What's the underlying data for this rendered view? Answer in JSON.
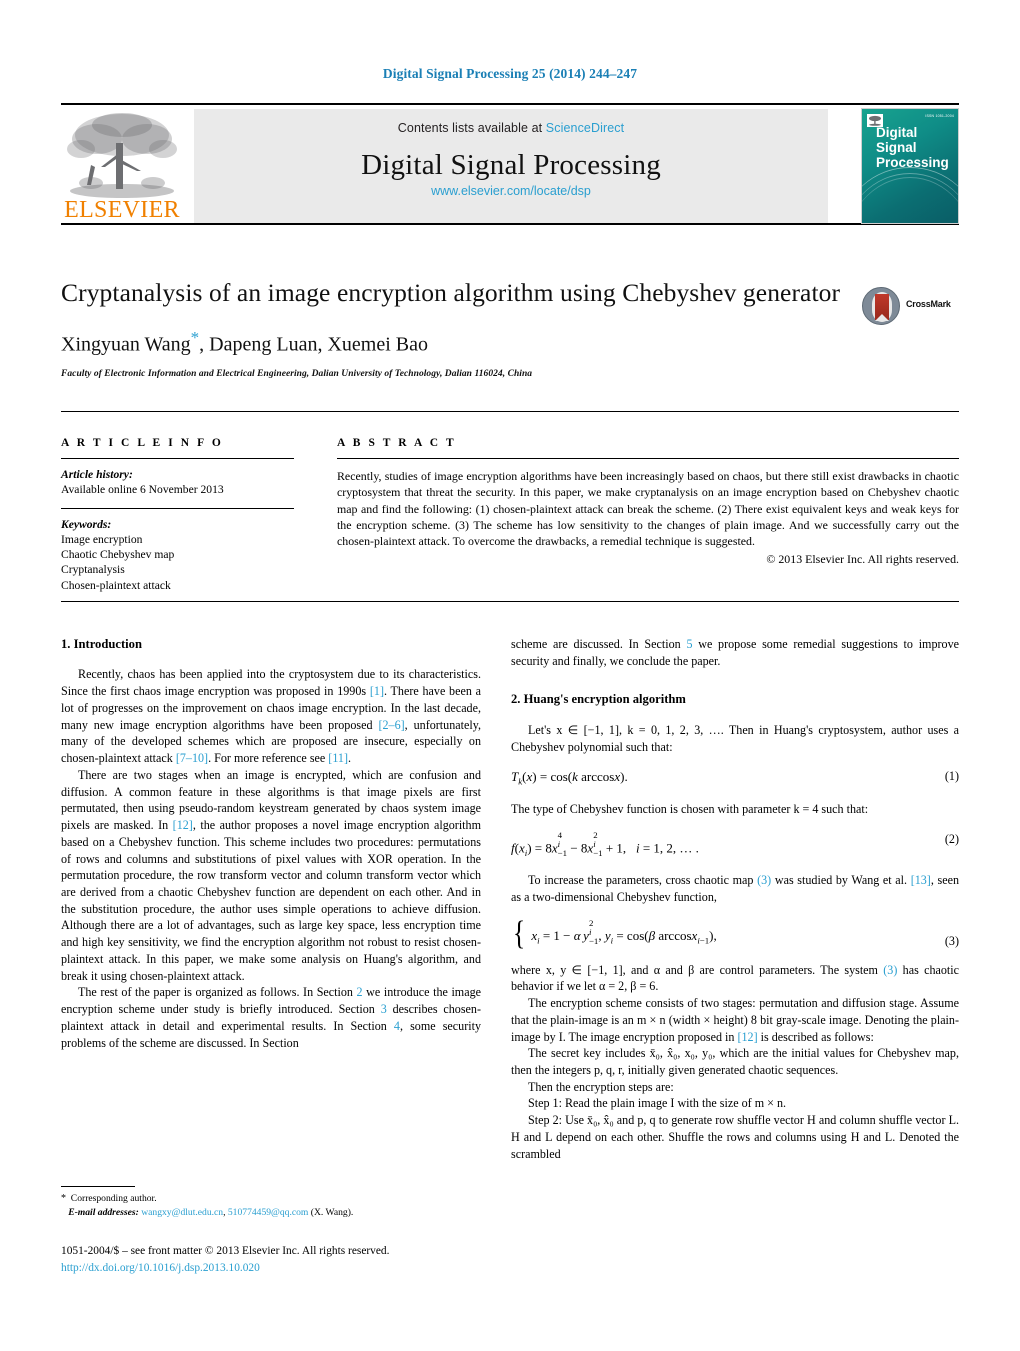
{
  "running_head": "Digital Signal Processing 25 (2014) 244–247",
  "masthead": {
    "publisher_logo_text": "ELSEVIER",
    "contents_prefix": "Contents lists available at ",
    "contents_link": "ScienceDirect",
    "journal_title": "Digital Signal Processing",
    "journal_url": "www.elsevier.com/locate/dsp",
    "cover_title_line1": "Digital",
    "cover_title_line2": "Signal",
    "cover_title_line3": "Processing",
    "cover_corner_text": "ISSN 1051-2004"
  },
  "article": {
    "title": "Cryptanalysis of an image encryption algorithm using Chebyshev generator",
    "authors": "Xingyuan Wang",
    "authors_rest": ", Dapeng Luan, Xuemei Bao",
    "corresponding_marker": "*",
    "affiliation": "Faculty of Electronic Information and Electrical Engineering, Dalian University of Technology, Dalian 116024, China",
    "crossmark_label": "CrossMark"
  },
  "info": {
    "heading": "A R T I C L E   I N F O",
    "history_label": "Article history:",
    "history_value": "Available online 6 November 2013",
    "keywords_label": "Keywords:",
    "keywords": [
      "Image encryption",
      "Chaotic Chebyshev map",
      "Cryptanalysis",
      "Chosen-plaintext attack"
    ]
  },
  "abstract": {
    "heading": "A B S T R A C T",
    "body": "Recently, studies of image encryption algorithms have been increasingly based on chaos, but there still exist drawbacks in chaotic cryptosystem that threat the security. In this paper, we make cryptanalysis on an image encryption based on Chebyshev chaotic map and find the following: (1) chosen-plaintext attack can break the scheme. (2) There exist equivalent keys and weak keys for the encryption scheme. (3) The scheme has low sensitivity to the changes of plain image. And we successfully carry out the chosen-plaintext attack. To overcome the drawbacks, a remedial technique is suggested.",
    "copyright": "© 2013 Elsevier Inc. All rights reserved."
  },
  "body": {
    "section1_heading": "1. Introduction",
    "p1_a": "Recently, chaos has been applied into the cryptosystem due to its characteristics. Since the first chaos image encryption was proposed in 1990s ",
    "p1_ref1": "[1]",
    "p1_b": ". There have been a lot of progresses on the improvement on chaos image encryption. In the last decade, many new image encryption algorithms have been proposed ",
    "p1_ref2": "[2–6]",
    "p1_c": ", unfortunately, many of the developed schemes which are proposed are insecure, especially on chosen-plaintext attack ",
    "p1_ref3": "[7–10]",
    "p1_d": ". For more reference see ",
    "p1_ref4": "[11]",
    "p1_e": ".",
    "p2_a": "There are two stages when an image is encrypted, which are confusion and diffusion. A common feature in these algorithms is that image pixels are first permutated, then using pseudo-random keystream generated by chaos system image pixels are masked. In ",
    "p2_ref1": "[12]",
    "p2_b": ", the author proposes a novel image encryption algorithm based on a Chebyshev function. This scheme includes two procedures: permutations of rows and columns and substitutions of pixel values with XOR operation. In the permutation procedure, the row transform vector and column transform vector which are derived from a chaotic Chebyshev function are dependent on each other. And in the substitution procedure, the author uses simple operations to achieve diffusion. Although there are a lot of advantages, such as large key space, less encryption time and high key sensitivity, we find the encryption algorithm not robust to resist chosen-plaintext attack. In this paper, we make some analysis on Huang's algorithm, and break it using chosen-plaintext attack.",
    "p3_a": "The rest of the paper is organized as follows. In Section ",
    "p3_ref1": "2",
    "p3_b": " we introduce the image encryption scheme under study is briefly introduced. Section ",
    "p3_ref2": "3",
    "p3_c": " describes chosen-plaintext attack in detail and experimental results. In Section ",
    "p3_ref3": "4",
    "p3_d": ", some security problems of the scheme are discussed. In Section ",
    "p3_ref4": "5",
    "p3_e": " we propose some remedial suggestions to improve security and finally, we conclude the paper.",
    "section2_heading": "2. Huang's encryption algorithm",
    "p4_a": "Let's x ∈ [−1, 1],  k = 0, 1, 2, 3, …. Then in Huang's cryptosystem, author uses a Chebyshev polynomial such that:",
    "eq1_text": "T",
    "eq1_number": "(1)",
    "p5_a": "The type of Chebyshev function is chosen with parameter k = 4 such that:",
    "eq2_number": "(2)",
    "p6_a": "To increase the parameters, cross chaotic map ",
    "p6_ref1": "(3)",
    "p6_b": " was studied by Wang et al. ",
    "p6_ref2": "[13]",
    "p6_c": ", seen as a two-dimensional Chebyshev function,",
    "eq3_number": "(3)",
    "p7_a": "where x, y ∈ [−1, 1], and α and β are control parameters. The system ",
    "p7_ref1": "(3)",
    "p7_b": " has chaotic behavior if we let α = 2, β = 6.",
    "p8_a": "The encryption scheme consists of two stages: permutation and diffusion stage. Assume that the plain-image is an m × n (width × height) 8 bit gray-scale image. Denoting the plain-image by I. The image encryption proposed in ",
    "p8_ref1": "[12]",
    "p8_b": " is described as follows:",
    "p9_text": "The secret key includes x̄₀, x̂₀, x₀, y₀, which are the initial values for Chebyshev map, then the integers p, q, r, initially given generated chaotic sequences.",
    "p10_text": "Then the encryption steps are:",
    "p11_text": "Step 1: Read the plain image I with the size of m × n.",
    "p12_text": "Step 2: Use x̄₀, x̂₀ and p, q to generate row shuffle vector H and column shuffle vector L. H and L depend on each other. Shuffle the rows and columns using H and L. Denoted the scrambled"
  },
  "footer": {
    "corresponding_marker": "*",
    "corresponding_label": "Corresponding author.",
    "email_label": "E-mail addresses:",
    "email1": "wangxy@dlut.edu.cn",
    "email_sep": ", ",
    "email2": "510774459@qq.com",
    "email_suffix": " (X. Wang).",
    "imprint": "1051-2004/$ – see front matter © 2013 Elsevier Inc. All rights reserved.",
    "doi": "http://dx.doi.org/10.1016/j.dsp.2013.10.020"
  },
  "colors": {
    "link": "#2a9fd0",
    "runhead": "#1a7fb5",
    "elsevier_orange": "#F08000",
    "cover_teal": "#0f8d87"
  }
}
